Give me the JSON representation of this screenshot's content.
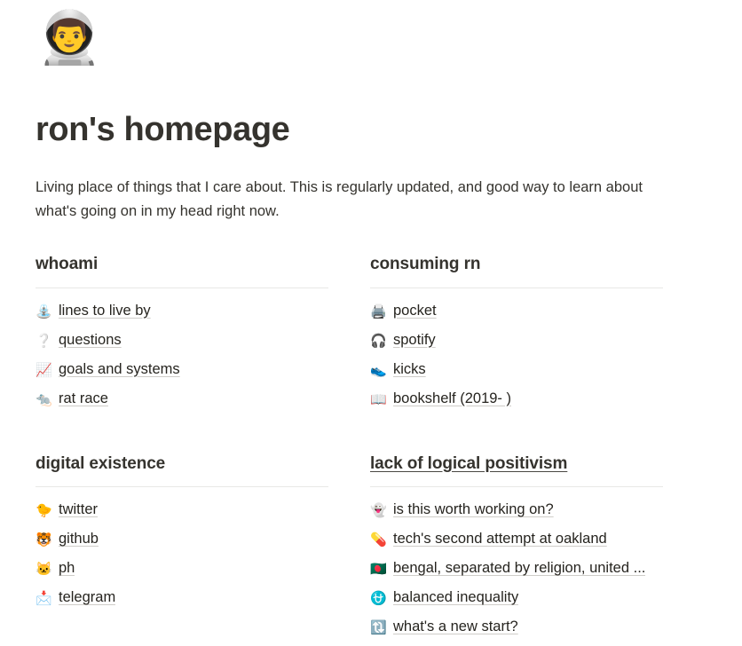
{
  "profile": {
    "avatar_icon": "astronaut-emoji",
    "avatar_glyph": "👨‍🚀",
    "title": "ron's homepage",
    "intro": "Living place of things that I care about. This is regularly updated, and good way to learn about what's going on in my head right now."
  },
  "sections": [
    {
      "id": "whoami",
      "heading": "whoami",
      "heading_is_link": false,
      "items": [
        {
          "icon_name": "fountain-icon",
          "icon": "⛲",
          "label": "lines to live by"
        },
        {
          "icon_name": "white-question-mark-icon",
          "icon": "❔",
          "label": "questions"
        },
        {
          "icon_name": "chart-increasing-icon",
          "icon": "📈",
          "label": "goals and systems"
        },
        {
          "icon_name": "rat-icon",
          "icon": "🐀",
          "label": "rat race"
        }
      ]
    },
    {
      "id": "consuming-rn",
      "heading": "consuming rn",
      "heading_is_link": false,
      "items": [
        {
          "icon_name": "printer-icon",
          "icon": "🖨️",
          "label": "pocket"
        },
        {
          "icon_name": "headphone-icon",
          "icon": "🎧",
          "label": "spotify"
        },
        {
          "icon_name": "running-shoe-icon",
          "icon": "👟",
          "label": "kicks"
        },
        {
          "icon_name": "open-book-icon",
          "icon": "📖",
          "label": "bookshelf (2019- )"
        }
      ]
    },
    {
      "id": "digital-existence",
      "heading": "digital existence",
      "heading_is_link": false,
      "items": [
        {
          "icon_name": "baby-chick-icon",
          "icon": "🐤",
          "label": "twitter"
        },
        {
          "icon_name": "tiger-face-icon",
          "icon": "🐯",
          "label": "github"
        },
        {
          "icon_name": "cat-face-icon",
          "icon": "🐱",
          "label": "ph"
        },
        {
          "icon_name": "incoming-envelope-icon",
          "icon": "📩",
          "label": "telegram"
        }
      ]
    },
    {
      "id": "lack-of-logical-positivism",
      "heading": "lack of logical positivism",
      "heading_is_link": true,
      "items": [
        {
          "icon_name": "ghost-icon",
          "icon": "👻",
          "label": "is this worth working on?"
        },
        {
          "icon_name": "pill-icon",
          "icon": "💊",
          "label": "tech's second attempt at oakland"
        },
        {
          "icon_name": "bangladesh-flag-icon",
          "icon": "🇧🇩",
          "label": "bengal, separated by religion, united ..."
        },
        {
          "icon_name": "ophiuchus-icon",
          "icon": "⛎",
          "label": "balanced inequality"
        },
        {
          "icon_name": "clockwise-arrows-icon",
          "icon": "🔃",
          "label": "what's a new start?"
        }
      ]
    }
  ],
  "colors": {
    "text": "#35332e",
    "link": "#26241f",
    "rule": "#e8e8e6",
    "link_underline": "#cfcdc9",
    "background": "#ffffff"
  }
}
